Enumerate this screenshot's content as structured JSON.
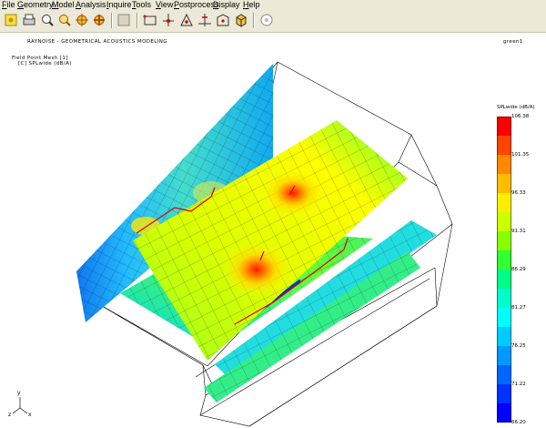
{
  "menu": {
    "items": [
      {
        "label": "File",
        "underline": "F"
      },
      {
        "label": "Geometry",
        "underline": "G"
      },
      {
        "label": "Model",
        "underline": "M"
      },
      {
        "label": "Analysis",
        "underline": "A"
      },
      {
        "label": "Inquire",
        "underline": "I"
      },
      {
        "label": "Tools",
        "underline": "T"
      },
      {
        "label": "View",
        "underline": "V"
      },
      {
        "label": "Postprocess",
        "underline": "P"
      },
      {
        "label": "Display",
        "underline": "D"
      },
      {
        "label": "Help",
        "underline": "H"
      }
    ]
  },
  "toolbar": {
    "buttons": [
      {
        "name": "new-icon"
      },
      {
        "name": "print-icon"
      },
      {
        "name": "zoom-icon"
      },
      {
        "name": "zoom-fit-icon"
      },
      {
        "name": "rotate-icon"
      },
      {
        "name": "pan-icon"
      },
      {
        "name": "blank-icon"
      },
      {
        "name": "select-box-icon"
      },
      {
        "name": "node-pick-icon"
      },
      {
        "name": "element-pick-icon"
      },
      {
        "name": "cut-plane-icon"
      },
      {
        "name": "frame-icon"
      },
      {
        "name": "cube-icon"
      },
      {
        "name": "stop-icon"
      }
    ]
  },
  "viewport": {
    "title": "RAYNOISE - GEOMETRICAL ACOUSTICS MODELING",
    "model_name": "green1",
    "mesh_label": "Field Point Mesh [1]",
    "result_label": "[C]  SPLwide (dB/A)",
    "axes": {
      "x": "x",
      "y": "y",
      "z": "z"
    }
  },
  "legend": {
    "title": "SPLwide (dB/A)",
    "labels": [
      "106.38",
      "101.35",
      "96.33",
      "91.31",
      "86.29",
      "81.27",
      "76.25",
      "71.22",
      "66.20"
    ],
    "colors": [
      "#ff0000",
      "#ff4400",
      "#ff8800",
      "#ffbb00",
      "#ffee00",
      "#ccff00",
      "#88ff00",
      "#33ff33",
      "#00ff88",
      "#00ffcc",
      "#00ffff",
      "#00ccff",
      "#0099ff",
      "#0066ff",
      "#0033ff",
      "#0000ff"
    ]
  }
}
